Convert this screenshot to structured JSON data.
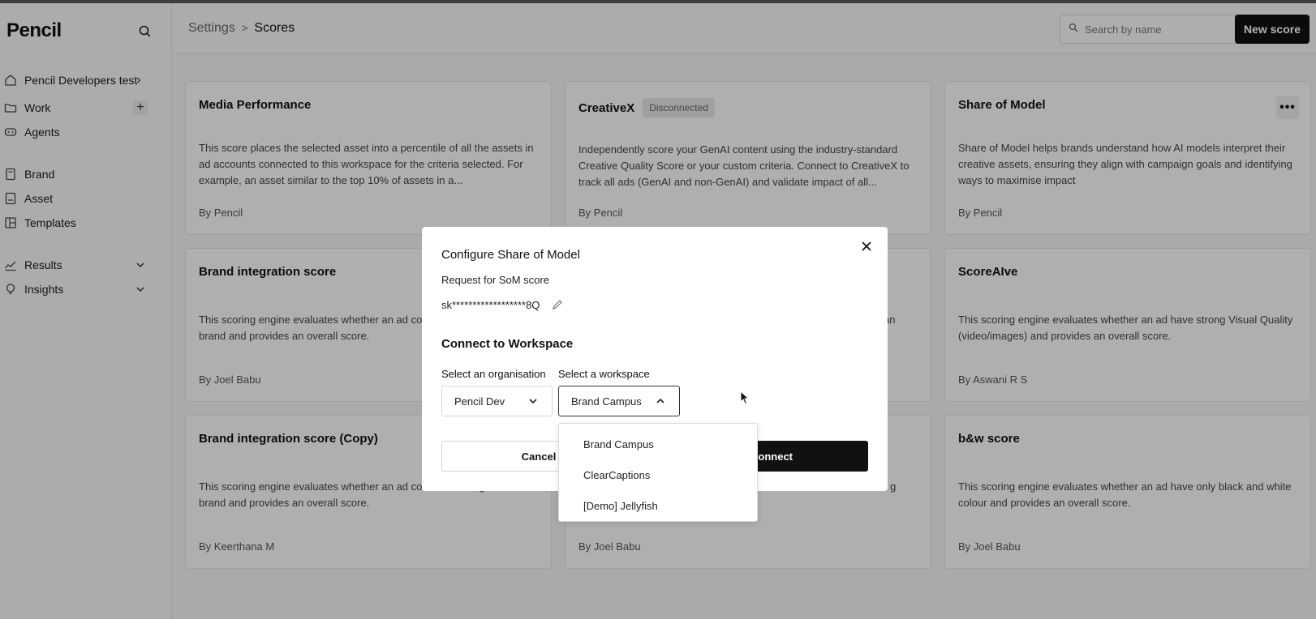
{
  "app": {
    "logo": "Pencil"
  },
  "sidebar": {
    "workspace": "Pencil Developers test",
    "items": [
      {
        "label": "Work",
        "icon": "folder-icon"
      },
      {
        "label": "Agents",
        "icon": "agents-icon"
      },
      {
        "label": "Brand",
        "icon": "book-icon"
      },
      {
        "label": "Asset",
        "icon": "asset-icon"
      },
      {
        "label": "Templates",
        "icon": "grid-icon"
      },
      {
        "label": "Results",
        "icon": "chart-icon"
      },
      {
        "label": "Insights",
        "icon": "bulb-icon"
      }
    ]
  },
  "header": {
    "breadcrumb_parent": "Settings",
    "breadcrumb_sep": ">",
    "breadcrumb_current": "Scores",
    "search_placeholder": "Search by name",
    "new_button": "New score"
  },
  "cards": [
    {
      "title": "Media Performance",
      "badge": "",
      "desc": "This score places the selected asset into a percentile of all the assets in ad accounts connected to this workspace for the criteria selected. For example, an asset similar to the top 10% of assets in a...",
      "by": "By Pencil"
    },
    {
      "title": "CreativeX",
      "badge": "Disconnected",
      "desc": "Independently score your GenAI content using the industry-standard Creative Quality Score or your custom criteria. Connect to CreativeX to track all ads (GenAI and non-GenAI) and validate impact of all...",
      "by": "By Pencil"
    },
    {
      "title": "Share of Model",
      "badge": "",
      "desc": "Share of Model helps brands understand how AI models interpret their creative assets, ensuring they align with campaign goals and identifying ways to maximise impact",
      "by": "By Pencil"
    },
    {
      "title": "Brand integration score",
      "badge": "",
      "desc": "This scoring engine evaluates whether an ad contains the logo of the brand and provides an overall score.",
      "by": "By Joel Babu"
    },
    {
      "title": "",
      "badge": "",
      "desc": "an",
      "by": ""
    },
    {
      "title": "ScoreAIve",
      "badge": "",
      "desc": "This scoring engine evaluates whether an ad have strong Visual Quality (video/images) and provides an overall score.",
      "by": "By Aswani R S"
    },
    {
      "title": "Brand integration score (Copy)",
      "badge": "",
      "desc": "This scoring engine evaluates whether an ad contains the logo of the brand and provides an overall score.",
      "by": "By Keerthana M"
    },
    {
      "title": "",
      "badge": "",
      "desc": "g",
      "by": "By Joel Babu"
    },
    {
      "title": "b&w score",
      "badge": "",
      "desc": "This scoring engine evaluates whether an ad have only black and white colour and provides an overall score.",
      "by": "By Joel Babu"
    }
  ],
  "modal": {
    "title": "Configure Share of Model",
    "subtitle": "Request for SoM score",
    "api_key": "sk******************8Q",
    "section_title": "Connect to Workspace",
    "org_label": "Select an organisation",
    "org_value": "Pencil Dev",
    "ws_label": "Select a workspace",
    "ws_value": "Brand Campus",
    "cancel": "Cancel",
    "connect": "Connect",
    "options": [
      "Brand Campus",
      "ClearCaptions",
      "[Demo] Jellyfish"
    ]
  }
}
